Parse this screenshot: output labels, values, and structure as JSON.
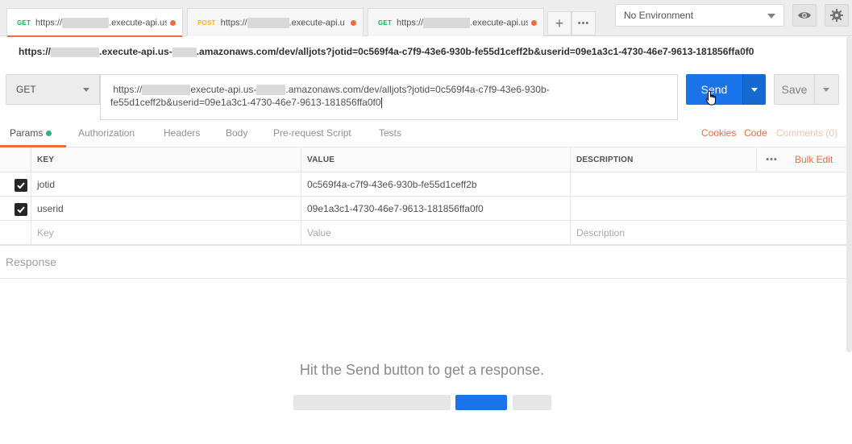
{
  "tabs": [
    {
      "method": "GET",
      "url_prefix": "https://",
      "url_suffix": ".execute-api.us"
    },
    {
      "method": "POST",
      "url_prefix": "https://",
      "url_suffix": ".execute-api.u"
    },
    {
      "method": "GET",
      "url_prefix": "https://",
      "url_suffix": ".execute-api.us"
    }
  ],
  "tab_add": "+",
  "tab_more": "•••",
  "environment": {
    "selected": "No Environment"
  },
  "request": {
    "title_a": "https://",
    "title_b": ".execute-api.us-",
    "title_c": ".amazonaws.com/dev/alljots?jotid=0c569f4a-c7f9-43e6-930b-fe55d1ceff2b&userid=09e1a3c1-4730-46e7-9613-181856ffa0f0",
    "method": "GET",
    "url_a": "https://",
    "url_b": "execute-api.us-",
    "url_c": ".amazonaws.com/dev/alljots?jotid=0c569f4a-c7f9-43e6-930b-",
    "url_line2": "fe55d1ceff2b&userid=09e1a3c1-4730-46e7-9613-181856ffa0f0",
    "send_label": "Send",
    "save_label": "Save"
  },
  "subtabs": [
    "Params",
    "Authorization",
    "Headers",
    "Body",
    "Pre-request Script",
    "Tests"
  ],
  "right_links": {
    "cookies": "Cookies",
    "code": "Code",
    "comments": "Comments (0)"
  },
  "colors": {
    "accent": "#f26b3a",
    "send": "#1a73e8",
    "get": "#0cbb52",
    "post": "#ffb400",
    "params_dot": "#26b47f"
  },
  "params": {
    "headers": {
      "key": "KEY",
      "value": "VALUE",
      "description": "DESCRIPTION"
    },
    "more": "•••",
    "bulk_edit": "Bulk Edit",
    "rows": [
      {
        "key": "jotid",
        "value": "0c569f4a-c7f9-43e6-930b-fe55d1ceff2b",
        "description": "",
        "checked": true
      },
      {
        "key": "userid",
        "value": "09e1a3c1-4730-46e7-9613-181856ffa0f0",
        "description": "",
        "checked": true
      }
    ],
    "placeholders": {
      "key": "Key",
      "value": "Value",
      "description": "Description"
    }
  },
  "response": {
    "label": "Response",
    "hint": "Hit the Send button to get a response."
  }
}
